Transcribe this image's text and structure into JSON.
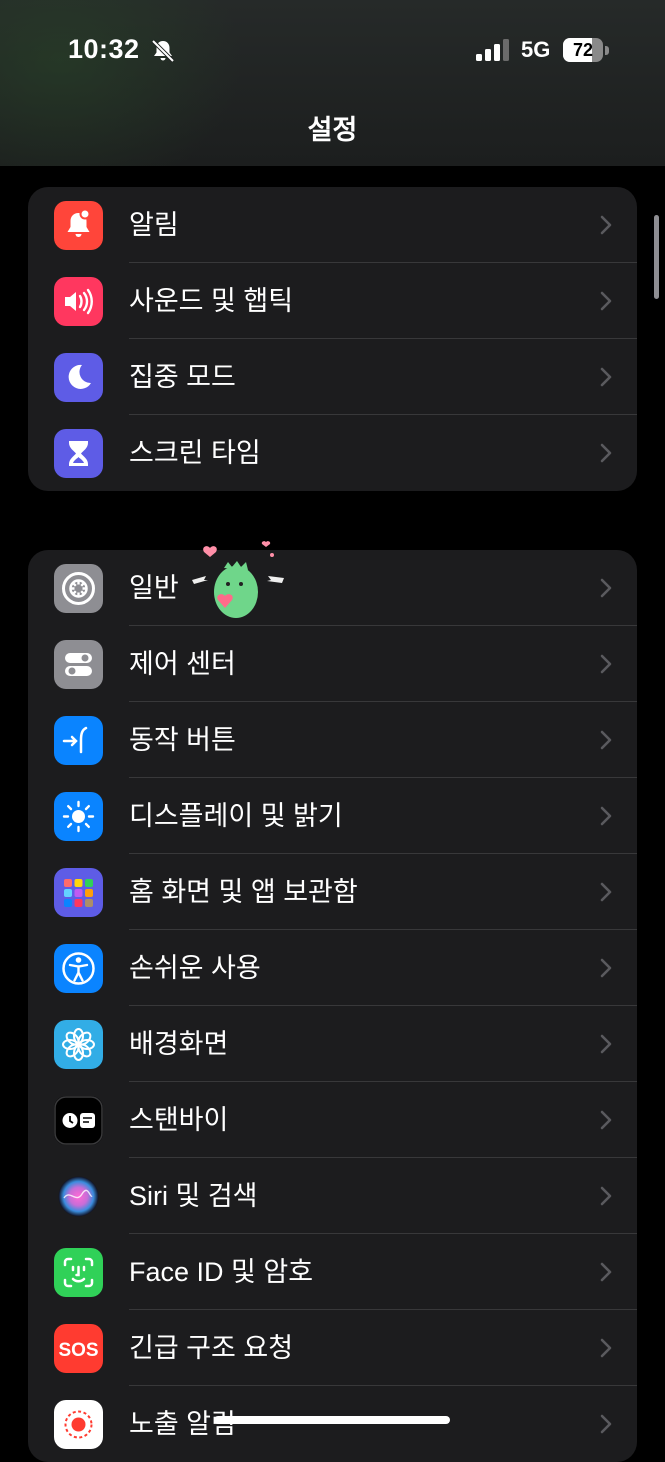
{
  "status_bar": {
    "time": "10:32",
    "network": "5G",
    "battery": 72
  },
  "title": "설정",
  "group1": [
    {
      "label": "알림",
      "icon": "notification-bell-icon",
      "color": "#ff453a"
    },
    {
      "label": "사운드 및 햅틱",
      "icon": "speaker-icon",
      "color": "#ff375f"
    },
    {
      "label": "집중 모드",
      "icon": "moon-icon",
      "color": "#5e5ce6"
    },
    {
      "label": "스크린 타임",
      "icon": "hourglass-icon",
      "color": "#5e5ce6"
    }
  ],
  "group2": [
    {
      "label": "일반",
      "icon": "gear-icon",
      "color": "#8e8e93"
    },
    {
      "label": "제어 센터",
      "icon": "toggle-switches-icon",
      "color": "#8e8e93"
    },
    {
      "label": "동작 버튼",
      "icon": "action-button-icon",
      "color": "#0a84ff"
    },
    {
      "label": "디스플레이 및 밝기",
      "icon": "sun-icon",
      "color": "#0a84ff"
    },
    {
      "label": "홈 화면 및 앱 보관함",
      "icon": "app-grid-icon",
      "color": "#5e5ce6"
    },
    {
      "label": "손쉬운 사용",
      "icon": "accessibility-icon",
      "color": "#0a84ff"
    },
    {
      "label": "배경화면",
      "icon": "flower-icon",
      "color": "#32ade6"
    },
    {
      "label": "스탠바이",
      "icon": "standby-icon",
      "color": "#000000"
    },
    {
      "label": "Siri 및 검색",
      "icon": "siri-orb-icon",
      "color": "#1c1c1e"
    },
    {
      "label": "Face ID 및 암호",
      "icon": "face-id-icon",
      "color": "#30d158"
    },
    {
      "label": "긴급 구조 요청",
      "icon": "sos-icon",
      "color": "#ff3b30"
    },
    {
      "label": "노출 알림",
      "icon": "exposure-notification-icon",
      "color": "#ffffff"
    }
  ],
  "sos_text": "SOS"
}
